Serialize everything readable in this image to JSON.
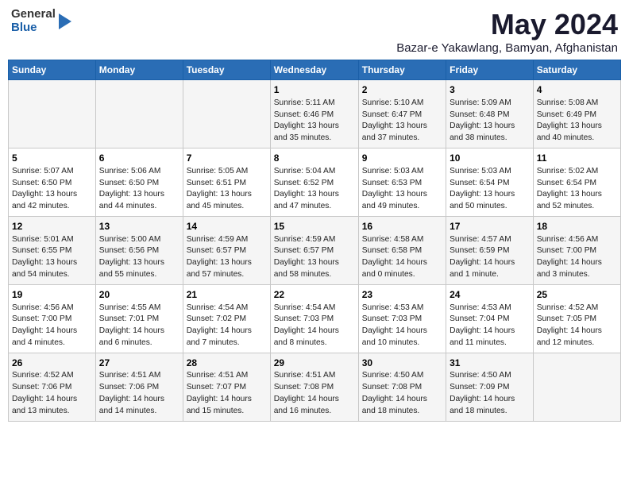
{
  "header": {
    "logo_general": "General",
    "logo_blue": "Blue",
    "month_title": "May 2024",
    "location": "Bazar-e Yakawlang, Bamyan, Afghanistan"
  },
  "days_of_week": [
    "Sunday",
    "Monday",
    "Tuesday",
    "Wednesday",
    "Thursday",
    "Friday",
    "Saturday"
  ],
  "weeks": [
    [
      {
        "day": "",
        "info": ""
      },
      {
        "day": "",
        "info": ""
      },
      {
        "day": "",
        "info": ""
      },
      {
        "day": "1",
        "info": "Sunrise: 5:11 AM\nSunset: 6:46 PM\nDaylight: 13 hours\nand 35 minutes."
      },
      {
        "day": "2",
        "info": "Sunrise: 5:10 AM\nSunset: 6:47 PM\nDaylight: 13 hours\nand 37 minutes."
      },
      {
        "day": "3",
        "info": "Sunrise: 5:09 AM\nSunset: 6:48 PM\nDaylight: 13 hours\nand 38 minutes."
      },
      {
        "day": "4",
        "info": "Sunrise: 5:08 AM\nSunset: 6:49 PM\nDaylight: 13 hours\nand 40 minutes."
      }
    ],
    [
      {
        "day": "5",
        "info": "Sunrise: 5:07 AM\nSunset: 6:50 PM\nDaylight: 13 hours\nand 42 minutes."
      },
      {
        "day": "6",
        "info": "Sunrise: 5:06 AM\nSunset: 6:50 PM\nDaylight: 13 hours\nand 44 minutes."
      },
      {
        "day": "7",
        "info": "Sunrise: 5:05 AM\nSunset: 6:51 PM\nDaylight: 13 hours\nand 45 minutes."
      },
      {
        "day": "8",
        "info": "Sunrise: 5:04 AM\nSunset: 6:52 PM\nDaylight: 13 hours\nand 47 minutes."
      },
      {
        "day": "9",
        "info": "Sunrise: 5:03 AM\nSunset: 6:53 PM\nDaylight: 13 hours\nand 49 minutes."
      },
      {
        "day": "10",
        "info": "Sunrise: 5:03 AM\nSunset: 6:54 PM\nDaylight: 13 hours\nand 50 minutes."
      },
      {
        "day": "11",
        "info": "Sunrise: 5:02 AM\nSunset: 6:54 PM\nDaylight: 13 hours\nand 52 minutes."
      }
    ],
    [
      {
        "day": "12",
        "info": "Sunrise: 5:01 AM\nSunset: 6:55 PM\nDaylight: 13 hours\nand 54 minutes."
      },
      {
        "day": "13",
        "info": "Sunrise: 5:00 AM\nSunset: 6:56 PM\nDaylight: 13 hours\nand 55 minutes."
      },
      {
        "day": "14",
        "info": "Sunrise: 4:59 AM\nSunset: 6:57 PM\nDaylight: 13 hours\nand 57 minutes."
      },
      {
        "day": "15",
        "info": "Sunrise: 4:59 AM\nSunset: 6:57 PM\nDaylight: 13 hours\nand 58 minutes."
      },
      {
        "day": "16",
        "info": "Sunrise: 4:58 AM\nSunset: 6:58 PM\nDaylight: 14 hours\nand 0 minutes."
      },
      {
        "day": "17",
        "info": "Sunrise: 4:57 AM\nSunset: 6:59 PM\nDaylight: 14 hours\nand 1 minute."
      },
      {
        "day": "18",
        "info": "Sunrise: 4:56 AM\nSunset: 7:00 PM\nDaylight: 14 hours\nand 3 minutes."
      }
    ],
    [
      {
        "day": "19",
        "info": "Sunrise: 4:56 AM\nSunset: 7:00 PM\nDaylight: 14 hours\nand 4 minutes."
      },
      {
        "day": "20",
        "info": "Sunrise: 4:55 AM\nSunset: 7:01 PM\nDaylight: 14 hours\nand 6 minutes."
      },
      {
        "day": "21",
        "info": "Sunrise: 4:54 AM\nSunset: 7:02 PM\nDaylight: 14 hours\nand 7 minutes."
      },
      {
        "day": "22",
        "info": "Sunrise: 4:54 AM\nSunset: 7:03 PM\nDaylight: 14 hours\nand 8 minutes."
      },
      {
        "day": "23",
        "info": "Sunrise: 4:53 AM\nSunset: 7:03 PM\nDaylight: 14 hours\nand 10 minutes."
      },
      {
        "day": "24",
        "info": "Sunrise: 4:53 AM\nSunset: 7:04 PM\nDaylight: 14 hours\nand 11 minutes."
      },
      {
        "day": "25",
        "info": "Sunrise: 4:52 AM\nSunset: 7:05 PM\nDaylight: 14 hours\nand 12 minutes."
      }
    ],
    [
      {
        "day": "26",
        "info": "Sunrise: 4:52 AM\nSunset: 7:06 PM\nDaylight: 14 hours\nand 13 minutes."
      },
      {
        "day": "27",
        "info": "Sunrise: 4:51 AM\nSunset: 7:06 PM\nDaylight: 14 hours\nand 14 minutes."
      },
      {
        "day": "28",
        "info": "Sunrise: 4:51 AM\nSunset: 7:07 PM\nDaylight: 14 hours\nand 15 minutes."
      },
      {
        "day": "29",
        "info": "Sunrise: 4:51 AM\nSunset: 7:08 PM\nDaylight: 14 hours\nand 16 minutes."
      },
      {
        "day": "30",
        "info": "Sunrise: 4:50 AM\nSunset: 7:08 PM\nDaylight: 14 hours\nand 18 minutes."
      },
      {
        "day": "31",
        "info": "Sunrise: 4:50 AM\nSunset: 7:09 PM\nDaylight: 14 hours\nand 18 minutes."
      },
      {
        "day": "",
        "info": ""
      }
    ]
  ]
}
